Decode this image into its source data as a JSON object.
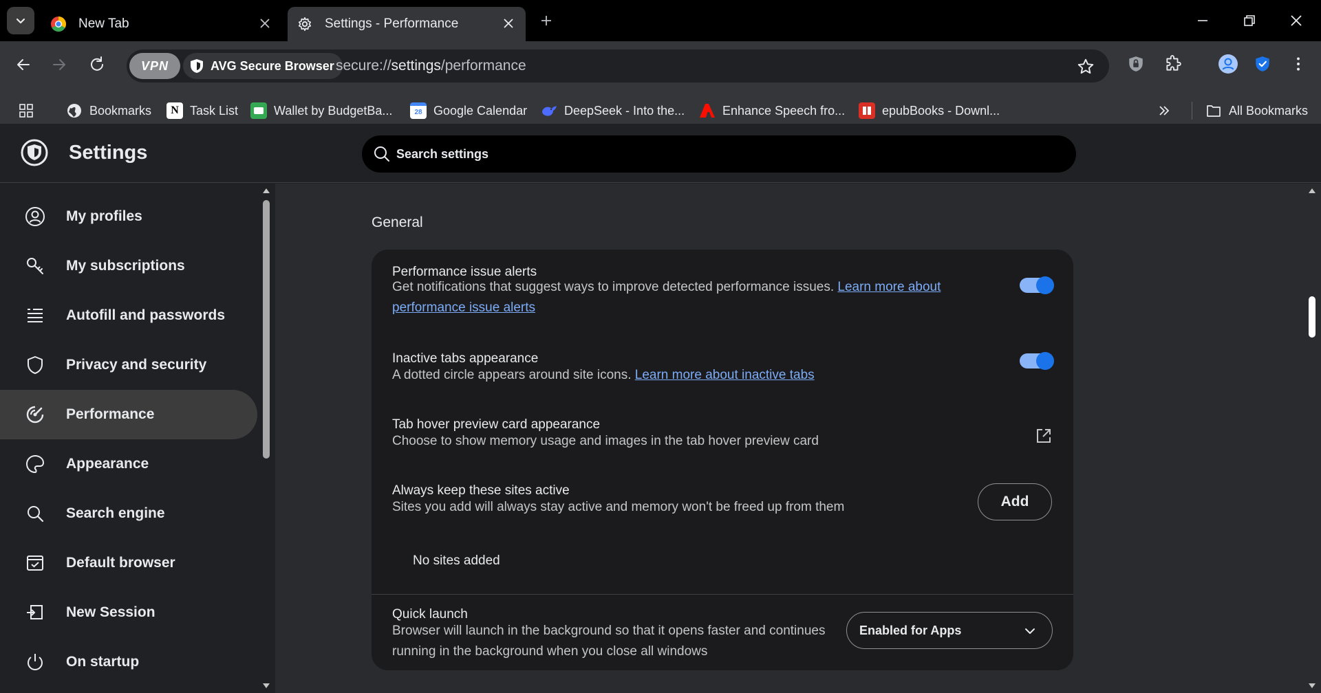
{
  "tabs": [
    {
      "title": "New Tab",
      "active": false
    },
    {
      "title": "Settings - Performance",
      "active": true
    }
  ],
  "omnibox": {
    "vpn_label": "VPN",
    "secure_label": "AVG Secure Browser",
    "url_scheme": "secure://",
    "url_host": "settings",
    "url_path": "/performance"
  },
  "bookmarks": [
    {
      "label": "Bookmarks",
      "icon": "globe-icon"
    },
    {
      "label": "Task List",
      "icon": "notion-icon"
    },
    {
      "label": "Wallet by BudgetBa...",
      "icon": "wallet-icon"
    },
    {
      "label": "Google Calendar",
      "icon": "calendar-icon"
    },
    {
      "label": "DeepSeek - Into the...",
      "icon": "deepseek-icon"
    },
    {
      "label": "Enhance Speech fro...",
      "icon": "adobe-icon"
    },
    {
      "label": "epubBooks - Downl...",
      "icon": "book-icon"
    }
  ],
  "all_bookmarks_label": "All Bookmarks",
  "header": {
    "title": "Settings",
    "search_placeholder": "Search settings"
  },
  "sidebar": {
    "items": [
      {
        "label": "My profiles",
        "icon": "profile-icon",
        "active": false
      },
      {
        "label": "My subscriptions",
        "icon": "key-icon",
        "active": false
      },
      {
        "label": "Autofill and passwords",
        "icon": "list-icon",
        "active": false
      },
      {
        "label": "Privacy and security",
        "icon": "shield-icon",
        "active": false
      },
      {
        "label": "Performance",
        "icon": "speedometer-icon",
        "active": true
      },
      {
        "label": "Appearance",
        "icon": "palette-icon",
        "active": false
      },
      {
        "label": "Search engine",
        "icon": "search-icon",
        "active": false
      },
      {
        "label": "Default browser",
        "icon": "browser-icon",
        "active": false
      },
      {
        "label": "New Session",
        "icon": "session-icon",
        "active": false
      },
      {
        "label": "On startup",
        "icon": "power-icon",
        "active": false
      }
    ]
  },
  "main": {
    "section_title": "General",
    "perf_alerts": {
      "title": "Performance issue alerts",
      "desc": "Get notifications that suggest ways to improve detected performance issues.",
      "link": "Learn more about performance issue alerts",
      "enabled": true
    },
    "inactive_tabs": {
      "title": "Inactive tabs appearance",
      "desc": "A dotted circle appears around site icons.",
      "link": "Learn more about inactive tabs",
      "enabled": true
    },
    "hover_preview": {
      "title": "Tab hover preview card appearance",
      "desc": "Choose to show memory usage and images in the tab hover preview card"
    },
    "keep_active": {
      "title": "Always keep these sites active",
      "desc": "Sites you add will always stay active and memory won't be freed up from them",
      "add_label": "Add",
      "empty_text": "No sites added"
    },
    "quick_launch": {
      "title": "Quick launch",
      "desc": "Browser will launch in the background so that it opens faster and continues running in the background when you close all windows",
      "selected": "Enabled for Apps"
    }
  },
  "colors": {
    "accent": "#8ab4f8",
    "link": "#7cacf8",
    "toggle_knob": "#1a73e8"
  }
}
